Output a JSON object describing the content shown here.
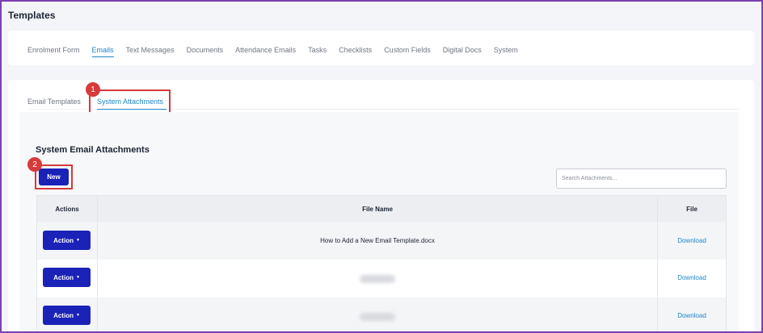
{
  "page": {
    "title": "Templates"
  },
  "main_tabs": [
    {
      "label": "Enrolment Form"
    },
    {
      "label": "Emails"
    },
    {
      "label": "Text Messages"
    },
    {
      "label": "Documents"
    },
    {
      "label": "Attendance Emails"
    },
    {
      "label": "Tasks"
    },
    {
      "label": "Checklists"
    },
    {
      "label": "Custom Fields"
    },
    {
      "label": "Digital Docs"
    },
    {
      "label": "System"
    }
  ],
  "active_main_tab": "Emails",
  "sub_tabs": {
    "email_templates": "Email Templates",
    "system_attachments": "System Attachments"
  },
  "section": {
    "title": "System Email Attachments",
    "new_label": "New",
    "search_placeholder": "Search Attachments..."
  },
  "annotations": {
    "step1": "1",
    "step2": "2"
  },
  "table": {
    "headers": {
      "actions": "Actions",
      "file_name": "File Name",
      "file": "File"
    },
    "rows": [
      {
        "action_label": "Action",
        "file_name": "How to Add a New Email Template.docx",
        "file_link": "Download"
      },
      {
        "action_label": "Action",
        "file_name": "",
        "file_link": "Download"
      },
      {
        "action_label": "Action",
        "file_name": "",
        "file_link": "Download"
      }
    ]
  },
  "colors": {
    "accent": "#1e86c8",
    "button": "#1a22b8",
    "highlight": "#d63a3a",
    "frame": "#7b3fb3"
  },
  "icons": {
    "dropdown_caret": "caret-down-icon"
  }
}
